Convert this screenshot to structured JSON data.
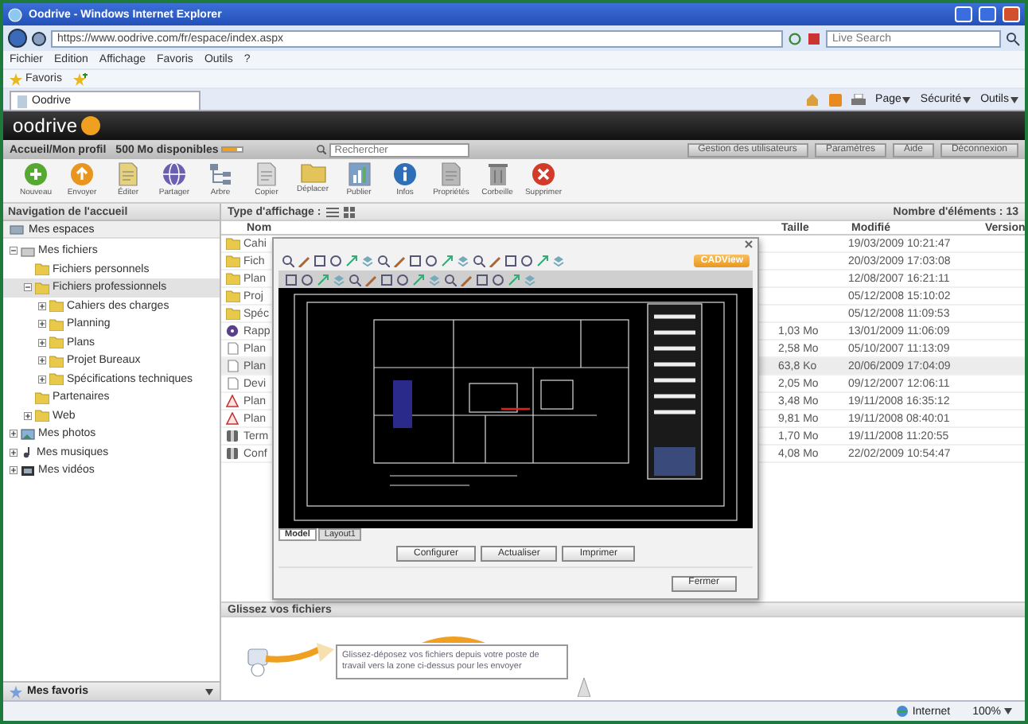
{
  "browser": {
    "title": "Oodrive - Windows Internet Explorer",
    "address": "https://www.oodrive.com/fr/espace/index.aspx",
    "search": {
      "placeholder": "Live Search"
    },
    "menu": [
      "Fichier",
      "Edition",
      "Affichage",
      "Favoris",
      "Outils",
      "?"
    ],
    "favorites": "Favoris",
    "tab": "Oodrive",
    "commands": [
      "Page",
      "Sécurité",
      "Outils"
    ]
  },
  "app": {
    "logo": "oodrive",
    "account": "Accueil/Mon profil",
    "quota": {
      "text": "500 Mo disponibles",
      "level": 0.7
    },
    "search": {
      "placeholder": "Rechercher"
    },
    "top_buttons": [
      "Gestion des utilisateurs",
      "Paramètres",
      "Aide",
      "Déconnexion"
    ],
    "toolbar": [
      {
        "label": "Nouveau",
        "kind": "plus",
        "color": "#55a832"
      },
      {
        "label": "Envoyer",
        "kind": "upload",
        "color": "#e8961e"
      },
      {
        "label": "Éditer",
        "kind": "document",
        "color": "#e6d27a"
      },
      {
        "label": "Partager",
        "kind": "share",
        "color": "#6a5fb0"
      },
      {
        "label": "Arbre",
        "kind": "tree",
        "color": "#7a8aa0"
      },
      {
        "label": "Copier",
        "kind": "document",
        "color": "#d8d8d8"
      },
      {
        "label": "Déplacer",
        "kind": "folder",
        "color": "#e2c45a"
      },
      {
        "label": "Publier",
        "kind": "chart",
        "color": "#7aa0c8"
      },
      {
        "label": "Infos",
        "kind": "info",
        "color": "#2f6fb8"
      },
      {
        "label": "Propriétés",
        "kind": "document",
        "color": "#b8b8b8"
      },
      {
        "label": "Corbeille",
        "kind": "bin",
        "color": "#a0a0a0"
      },
      {
        "label": "Supprimer",
        "kind": "delete",
        "color": "#d23a2a"
      }
    ]
  },
  "sidebar": {
    "title": "Navigation de l'accueil",
    "root": "Mes espaces",
    "items": [
      {
        "label": "Mes fichiers",
        "kind": "drive",
        "expanded": true,
        "selected": false,
        "children": [
          {
            "label": "Fichiers personnels",
            "kind": "folder",
            "selected": false
          },
          {
            "label": "Fichiers professionnels",
            "kind": "folder",
            "expanded": true,
            "selected": true,
            "children": [
              {
                "label": "Cahiers des charges",
                "kind": "folder",
                "expanded": false,
                "selected": false
              },
              {
                "label": "Planning",
                "kind": "folder",
                "expanded": false,
                "selected": false
              },
              {
                "label": "Plans",
                "kind": "folder",
                "expanded": false,
                "selected": false
              },
              {
                "label": "Projet Bureaux",
                "kind": "folder",
                "expanded": false,
                "selected": false
              },
              {
                "label": "Spécifications techniques",
                "kind": "folder",
                "expanded": false,
                "selected": false
              }
            ]
          },
          {
            "label": "Partenaires",
            "kind": "folder",
            "selected": false
          },
          {
            "label": "Web",
            "kind": "folder",
            "expanded": false,
            "selected": false
          }
        ]
      },
      {
        "label": "Mes photos",
        "kind": "photo",
        "expanded": false,
        "selected": false
      },
      {
        "label": "Mes musiques",
        "kind": "music",
        "expanded": false,
        "selected": false
      },
      {
        "label": "Mes vidéos",
        "kind": "video",
        "expanded": false,
        "selected": false
      }
    ],
    "footer": "Mes favoris"
  },
  "files": {
    "view_label": "Type d'affichage :",
    "count": "Nombre d'éléments : 13",
    "columns": [
      "Nom",
      "Taille",
      "Modifié",
      "Version"
    ],
    "rows": [
      {
        "name": "Cahi",
        "kind": "folder",
        "modified": "19/03/2009 10:21:47",
        "selected": false
      },
      {
        "name": "Fich",
        "kind": "folder",
        "modified": "20/03/2009 17:03:08",
        "selected": false
      },
      {
        "name": "Plan",
        "kind": "folder",
        "modified": "12/08/2007 16:21:11",
        "selected": false
      },
      {
        "name": "Proj",
        "kind": "folder",
        "modified": "05/12/2008 15:10:02",
        "selected": false
      },
      {
        "name": "Spéc",
        "kind": "folder",
        "modified": "05/12/2008 11:09:53",
        "selected": false
      },
      {
        "name": "Rapp",
        "kind": "media",
        "size": "1,03 Mo",
        "modified": "13/01/2009 11:06:09",
        "selected": false
      },
      {
        "name": "Plan",
        "kind": "document",
        "size": "2,58 Mo",
        "modified": "05/10/2007 11:13:09",
        "selected": false
      },
      {
        "name": "Plan",
        "kind": "document",
        "size": "63,8 Ko",
        "modified": "20/06/2009 17:04:09",
        "selected": true
      },
      {
        "name": "Devi",
        "kind": "document",
        "size": "2,05 Mo",
        "modified": "09/12/2007 12:06:11",
        "selected": false
      },
      {
        "name": "Plan",
        "kind": "pdf",
        "size": "3,48 Mo",
        "modified": "19/11/2008 16:35:12",
        "selected": false
      },
      {
        "name": "Plan",
        "kind": "pdf",
        "size": "9,81 Mo",
        "modified": "19/11/2008 08:40:01",
        "selected": false
      },
      {
        "name": "Term",
        "kind": "package",
        "size": "1,70 Mo",
        "modified": "19/11/2008 11:20:55",
        "selected": false
      },
      {
        "name": "Conf",
        "kind": "package",
        "size": "4,08 Mo",
        "modified": "22/02/2009 10:54:47",
        "selected": false
      }
    ]
  },
  "viewer": {
    "logo": "CADView",
    "tabs": [
      {
        "label": "Model",
        "selected": true
      },
      {
        "label": "Layout1",
        "selected": false
      }
    ],
    "buttons": [
      "Configurer",
      "Actualiser",
      "Imprimer"
    ],
    "close_button": "Fermer"
  },
  "drop": {
    "title": "Glissez vos fichiers",
    "hint": "Glissez-déposez vos fichiers depuis votre poste de travail vers la zone ci-dessus pour les envoyer"
  },
  "status_bar": {
    "zone": "Internet",
    "zoom": "100%"
  }
}
